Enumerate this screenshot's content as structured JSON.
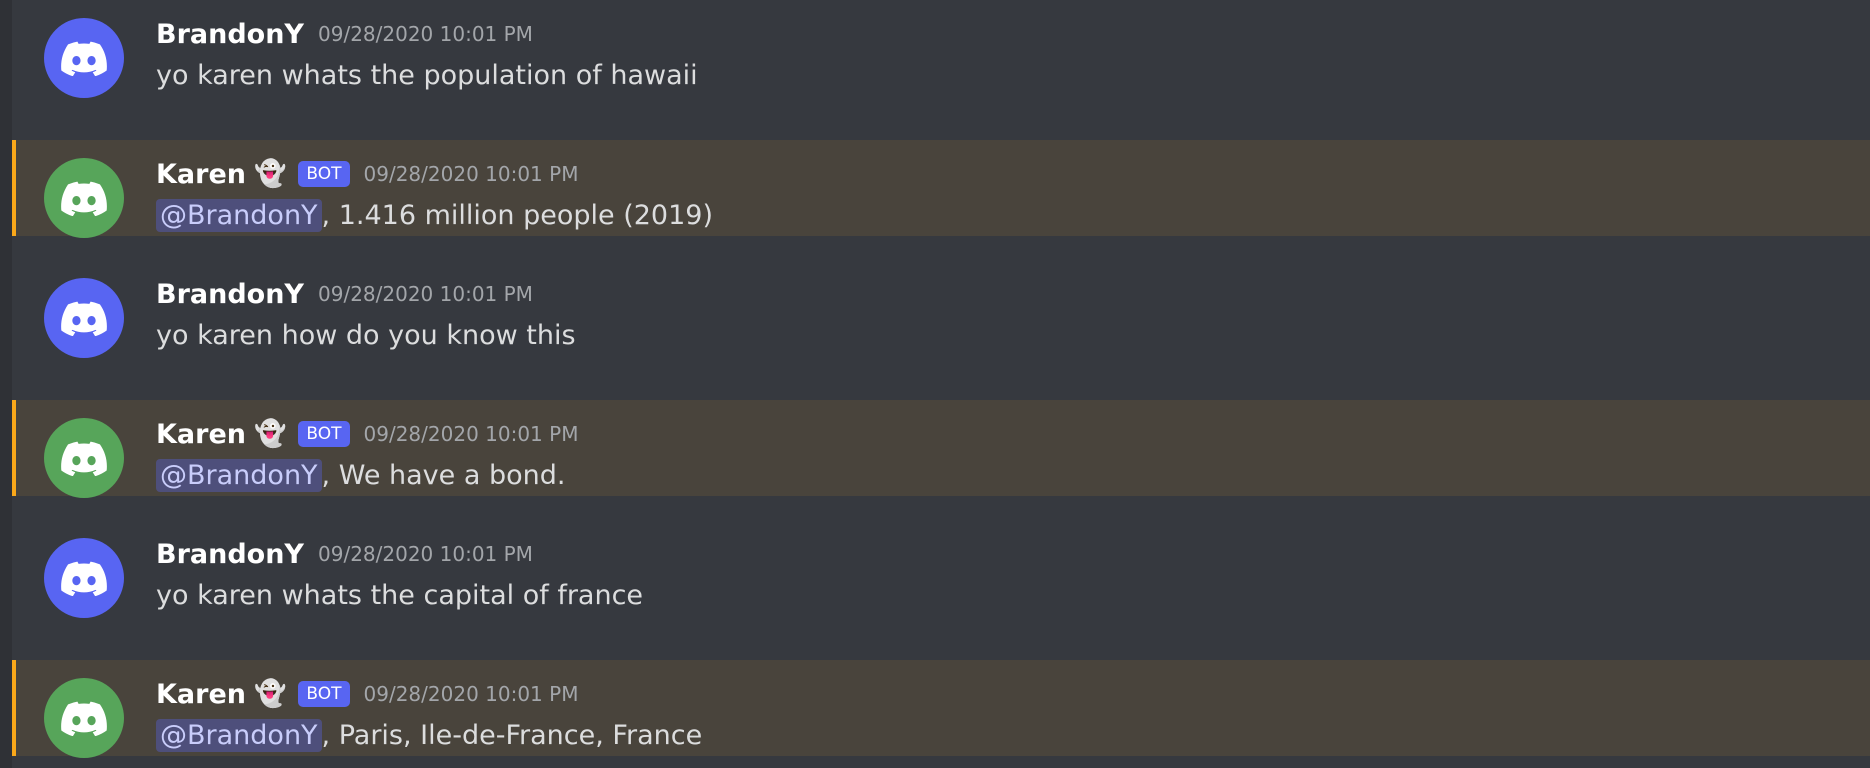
{
  "colors": {
    "background": "#36393f",
    "mention_highlight": "#49443c",
    "mention_border": "#faa81a",
    "user_avatar": "#5865f2",
    "bot_avatar": "#57a55a",
    "bot_tag": "#5865f2"
  },
  "messages": [
    {
      "author": "BrandonY",
      "is_bot": false,
      "avatar_icon": "discord-logo-icon",
      "timestamp": "09/28/2020 10:01 PM",
      "text": "yo karen whats the population of hawaii"
    },
    {
      "author": "Karen",
      "emoji": "👻",
      "is_bot": true,
      "bot_tag": "BOT",
      "avatar_icon": "discord-logo-icon",
      "timestamp": "09/28/2020 10:01 PM",
      "mention": "@BrandonY",
      "text": ", 1.416 million people (2019)"
    },
    {
      "author": "BrandonY",
      "is_bot": false,
      "avatar_icon": "discord-logo-icon",
      "timestamp": "09/28/2020 10:01 PM",
      "text": "yo karen how do you know this"
    },
    {
      "author": "Karen",
      "emoji": "👻",
      "is_bot": true,
      "bot_tag": "BOT",
      "avatar_icon": "discord-logo-icon",
      "timestamp": "09/28/2020 10:01 PM",
      "mention": "@BrandonY",
      "text": ", We have a bond."
    },
    {
      "author": "BrandonY",
      "is_bot": false,
      "avatar_icon": "discord-logo-icon",
      "timestamp": "09/28/2020 10:01 PM",
      "text": "yo karen whats the capital of france"
    },
    {
      "author": "Karen",
      "emoji": "👻",
      "is_bot": true,
      "bot_tag": "BOT",
      "avatar_icon": "discord-logo-icon",
      "timestamp": "09/28/2020 10:01 PM",
      "mention": "@BrandonY",
      "text": ", Paris, Ile-de-France, France"
    }
  ]
}
